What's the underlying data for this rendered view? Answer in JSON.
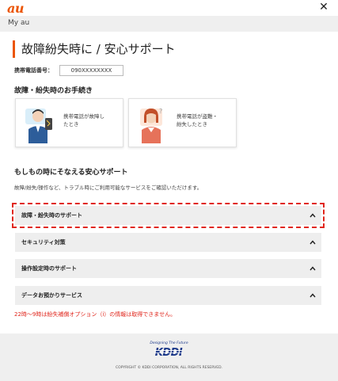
{
  "header": {
    "logo": "au",
    "close_icon": "close-icon"
  },
  "subbar": {
    "label": "My au"
  },
  "page": {
    "title": "故障紛失時に / 安心サポート",
    "accent_color": "#eb5505"
  },
  "phone": {
    "label": "携帯電話番号：",
    "value": "090XXXXXXXX"
  },
  "procedures": {
    "title": "故障・紛失時のお手続き",
    "cards": [
      {
        "label_line1": "携帯電話が故障し",
        "label_line2": "たとき",
        "icon": "broken-phone-man-illustration"
      },
      {
        "label_line1": "携帯電話が盗難・",
        "label_line2": "紛失したとき",
        "icon": "lost-phone-woman-illustration"
      }
    ]
  },
  "support": {
    "title": "もしもの時にそなえる安心サポート",
    "description": "故障/紛失/操作など、トラブル時にご利用可能なサービスをご確認いただけます。",
    "items": [
      {
        "label": "故障・紛失時のサポート",
        "icon": "chevron-up-icon"
      },
      {
        "label": "セキュリティ対策",
        "icon": "chevron-up-icon"
      },
      {
        "label": "操作設定時のサポート",
        "icon": "chevron-up-icon"
      },
      {
        "label": "データお預かりサービス",
        "icon": "chevron-up-icon"
      }
    ],
    "highlight_color": "#e0261c"
  },
  "notice": "22時～9時は紛失補償オプション（i）の情報は取得できません。",
  "footer": {
    "tagline": "Designing The Future",
    "logo_text": "KDDI",
    "copyright": "COPYRIGHT © KDDI CORPORATION, ALL RIGHTS RESERVED."
  }
}
